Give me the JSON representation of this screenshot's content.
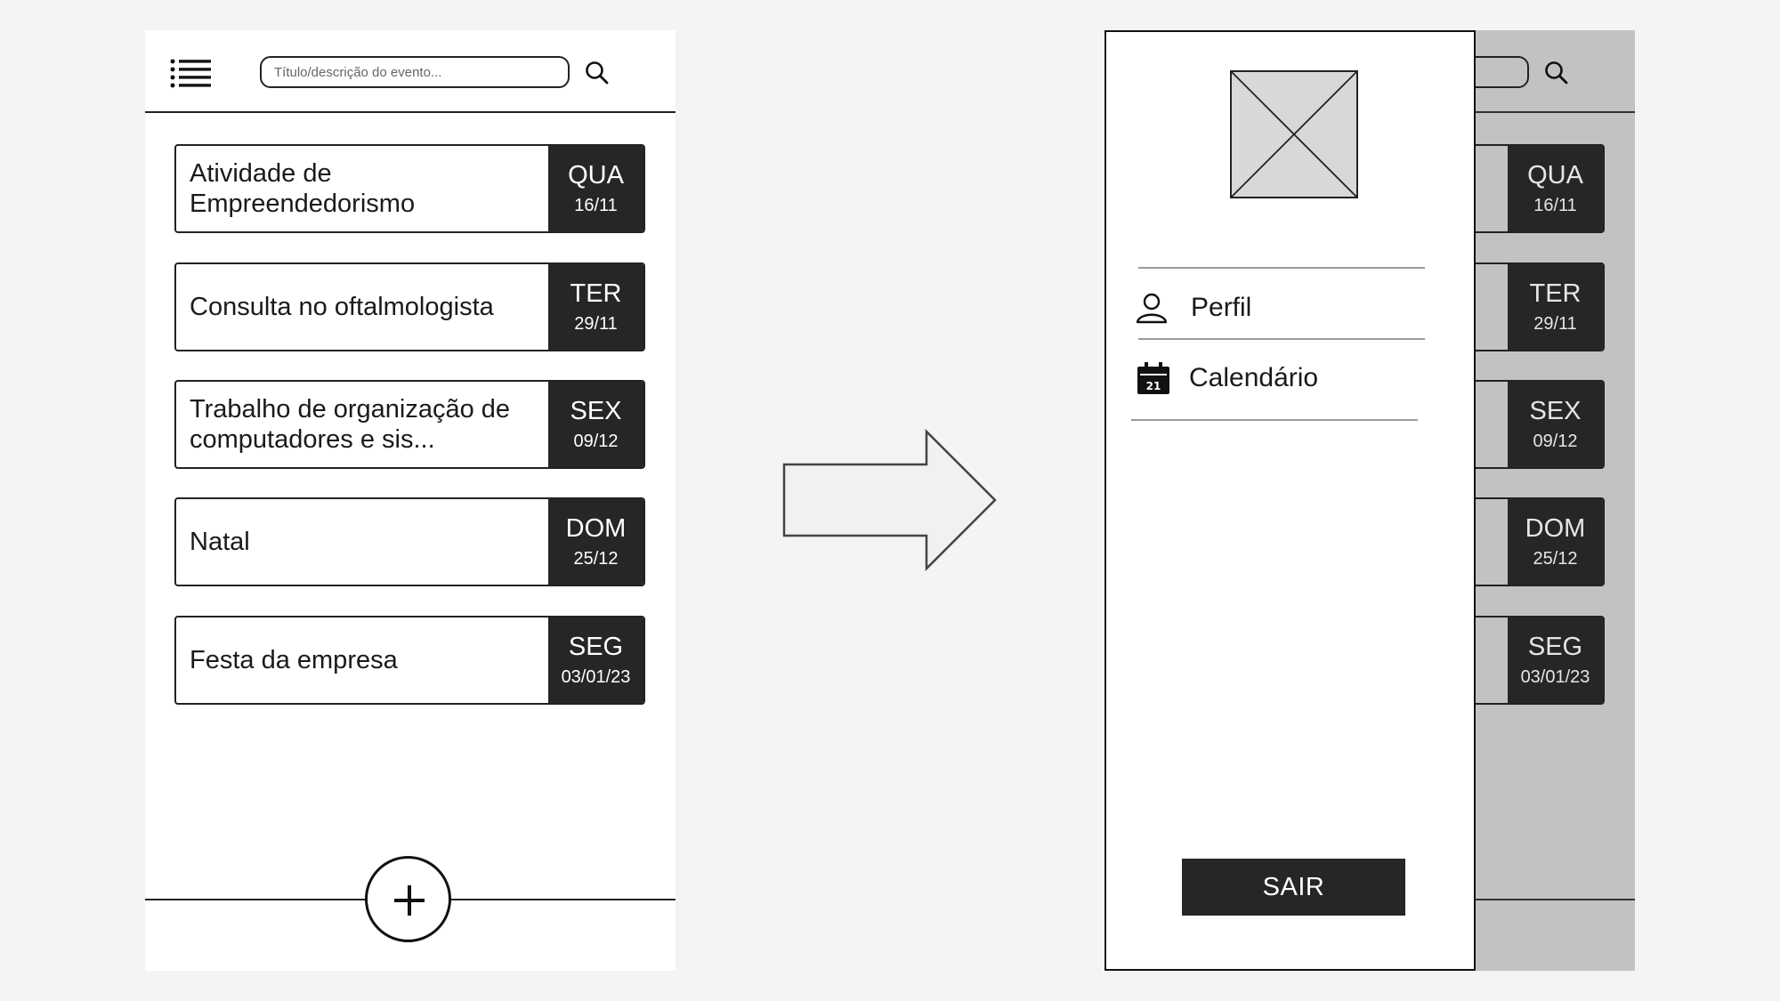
{
  "screens": {
    "left": {
      "search": {
        "placeholder": "Título/descrição do evento..."
      },
      "events": [
        {
          "title": "Atividade de Empreendedorismo",
          "weekday": "QUA",
          "date": "16/11"
        },
        {
          "title": "Consulta no oftalmologista",
          "weekday": "TER",
          "date": "29/11"
        },
        {
          "title": "Trabalho de organização de computadores e sis...",
          "weekday": "SEX",
          "date": "09/12"
        },
        {
          "title": "Natal",
          "weekday": "DOM",
          "date": "25/12"
        },
        {
          "title": "Festa da empresa",
          "weekday": "SEG",
          "date": "03/01/23"
        }
      ]
    },
    "right_background": {
      "events": [
        {
          "weekday": "QUA",
          "date": "16/11"
        },
        {
          "weekday": "TER",
          "date": "29/11"
        },
        {
          "weekday": "SEX",
          "date": "09/12"
        },
        {
          "weekday": "DOM",
          "date": "25/12"
        },
        {
          "weekday": "SEG",
          "date": "03/01/23"
        }
      ]
    }
  },
  "drawer": {
    "menu": [
      {
        "label": "Perfil",
        "icon": "user-icon"
      },
      {
        "label": "Calendário",
        "icon": "calendar-icon"
      }
    ],
    "calendar_icon_day": "21",
    "logout_label": "SAIR"
  }
}
